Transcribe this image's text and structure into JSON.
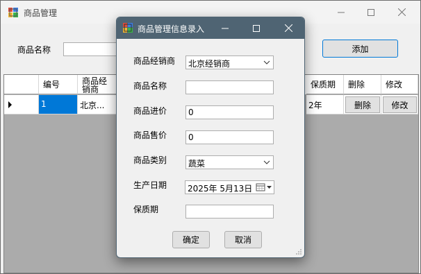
{
  "main": {
    "title": "商品管理",
    "search_label": "商品名称",
    "search_value": "",
    "add_button": "添加"
  },
  "grid": {
    "headers": [
      "编号",
      "商品经销商",
      "保质期",
      "删除",
      "修改"
    ],
    "row": {
      "id": "1",
      "dealer": "北京...",
      "shelf_life": "2年",
      "delete": "删除",
      "edit": "修改"
    }
  },
  "dialog": {
    "title": "商品管理信息录入",
    "dealer_label": "商品经销商",
    "dealer_value": "北京经销商",
    "name_label": "商品名称",
    "name_value": "",
    "cost_label": "商品进价",
    "cost_value": "0",
    "price_label": "商品售价",
    "price_value": "0",
    "category_label": "商品类别",
    "category_value": "蔬菜",
    "date_label": "生产日期",
    "date_value": "2025年  5月13日",
    "shelf_label": "保质期",
    "shelf_value": "",
    "ok_button": "确定",
    "cancel_button": "取消"
  },
  "icons": {
    "app": "app-icon",
    "minimize": "minimize-icon",
    "maximize": "maximize-icon",
    "close": "close-icon",
    "dropdown": "chevron-down-icon",
    "calendar": "calendar-icon",
    "row_indicator": "row-indicator-icon",
    "resize": "resize-grip-icon"
  },
  "colors": {
    "dialog_titlebar": "#4f6473",
    "selection": "#0078d7",
    "grid_background": "#ababab"
  }
}
